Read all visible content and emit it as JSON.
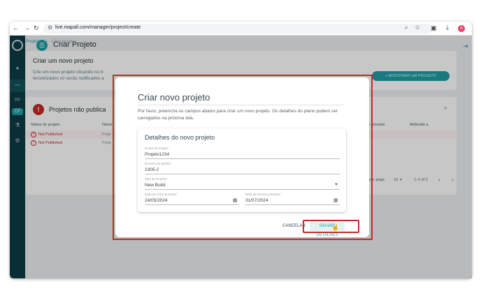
{
  "browser": {
    "url": "live.mapall.com/manager/project/create",
    "back_icon": "arrow-left-icon",
    "forward_icon": "arrow-right-icon",
    "reload_icon": "reload-icon",
    "profile_initial": "A"
  },
  "sidebar": {
    "items": [
      "PP",
      "CF"
    ]
  },
  "app": {
    "title": "Criar Projeto"
  },
  "breadcrumb": {
    "first": "Projetos",
    "separator": ">",
    "current": "Criar projeto"
  },
  "new_project_card": {
    "title": "Criar um novo projeto",
    "text_line1": "Crie um novo projeto clicando no b",
    "text_line2": "terceirizados só serão notificados a",
    "add_button": "+ ADICIONAR UM PROJETO"
  },
  "unpublished": {
    "title": "Projetos não publica",
    "columns": [
      "Status do projeto",
      "Nome",
      "ento previsto",
      "Atribuído a"
    ],
    "rows": [
      {
        "status": "Not Published",
        "name": "Proje"
      },
      {
        "status": "Not Published",
        "name": "Proje"
      }
    ],
    "pager": {
      "rows_label": "per page:",
      "rows_value": "10",
      "range": "1–2 of 2",
      "prev": "‹",
      "next": "›"
    }
  },
  "dialog": {
    "title": "Criar novo projeto",
    "description_line1": "Por favor, preencha os campos abaixo para criar um novo projeto. Os detalhes do plano podem ser",
    "description_line2": "carregados na próxima tela.",
    "section_title": "Detalhes do novo projeto",
    "fields": {
      "project_name": {
        "label": "Nome do Projeto",
        "value": "Projeto1234"
      },
      "order_number": {
        "label": "Número do pedido",
        "value": "2305-2"
      },
      "project_type": {
        "label": "Tipo de Projeto*",
        "value": "New Build"
      },
      "start_date": {
        "label": "Data de início prevista*",
        "value": "24/05/2024"
      },
      "end_date": {
        "label": "Data de término prevista*",
        "value": "31/07/2024"
      }
    },
    "cancel_label": "CANCELAR",
    "save_label": "SALVAR DETALHES"
  },
  "colors": {
    "accent": "#1d9da4",
    "sidebar": "#0e3b44",
    "highlight": "#c62828"
  }
}
